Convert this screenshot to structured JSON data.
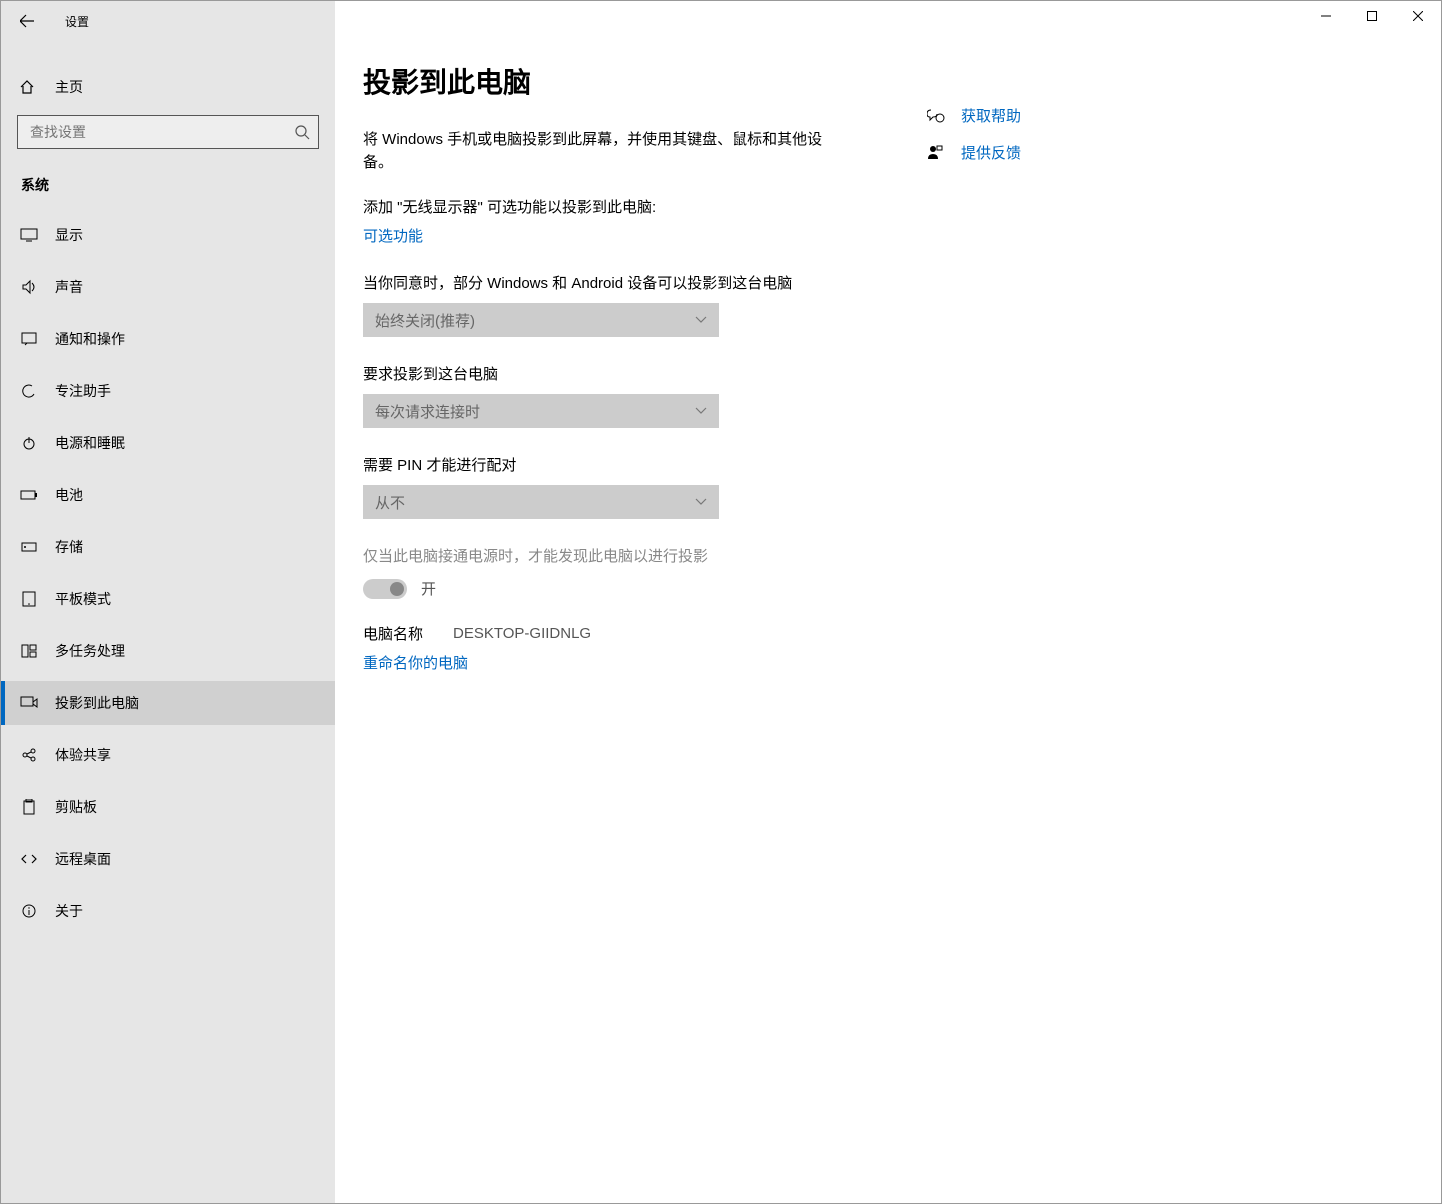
{
  "app": {
    "title": "设置"
  },
  "sidebar": {
    "home_label": "主页",
    "search_placeholder": "查找设置",
    "category_label": "系统",
    "items": [
      {
        "label": "显示",
        "icon": "display-icon"
      },
      {
        "label": "声音",
        "icon": "sound-icon"
      },
      {
        "label": "通知和操作",
        "icon": "notifications-icon"
      },
      {
        "label": "专注助手",
        "icon": "focus-assist-icon"
      },
      {
        "label": "电源和睡眠",
        "icon": "power-icon"
      },
      {
        "label": "电池",
        "icon": "battery-icon"
      },
      {
        "label": "存储",
        "icon": "storage-icon"
      },
      {
        "label": "平板模式",
        "icon": "tablet-icon"
      },
      {
        "label": "多任务处理",
        "icon": "multitask-icon"
      },
      {
        "label": "投影到此电脑",
        "icon": "project-icon",
        "active": true
      },
      {
        "label": "体验共享",
        "icon": "shared-icon"
      },
      {
        "label": "剪贴板",
        "icon": "clipboard-icon"
      },
      {
        "label": "远程桌面",
        "icon": "remote-icon"
      },
      {
        "label": "关于",
        "icon": "about-icon"
      }
    ]
  },
  "page": {
    "title": "投影到此电脑",
    "description": "将 Windows 手机或电脑投影到此屏幕，并使用其键盘、鼠标和其他设备。",
    "add_feature_text": "添加 \"无线显示器\" 可选功能以投影到此电脑:",
    "optional_features_link": "可选功能",
    "consent_label": "当你同意时，部分 Windows 和 Android 设备可以投影到这台电脑",
    "consent_value": "始终关闭(推荐)",
    "request_label": "要求投影到这台电脑",
    "request_value": "每次请求连接时",
    "pin_label": "需要 PIN 才能进行配对",
    "pin_value": "从不",
    "power_only_label": "仅当此电脑接通电源时，才能发现此电脑以进行投影",
    "toggle_state": "开",
    "pc_name_label": "电脑名称",
    "pc_name_value": "DESKTOP-GIIDNLG",
    "rename_link": "重命名你的电脑"
  },
  "side": {
    "help_label": "获取帮助",
    "feedback_label": "提供反馈"
  }
}
